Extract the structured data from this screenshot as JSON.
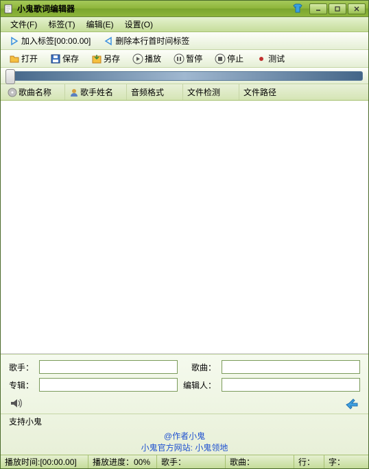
{
  "window": {
    "title": "小鬼歌词编辑器"
  },
  "menubar": [
    "文件(F)",
    "标签(T)",
    "编辑(E)",
    "设置(O)"
  ],
  "toolbar1": {
    "add_tag": "加入标签[00:00.00]",
    "del_tag": "删除本行首时间标签"
  },
  "toolbar2": {
    "open": "打开",
    "save": "保存",
    "saveas": "另存",
    "play": "播放",
    "pause": "暂停",
    "stop": "停止",
    "test": "测试"
  },
  "columns": [
    "歌曲名称",
    "歌手姓名",
    "音频格式",
    "文件检测",
    "文件路径"
  ],
  "meta": {
    "singer_label": "歌手：",
    "song_label": "歌曲：",
    "album_label": "专辑：",
    "editor_label": "编辑人：",
    "singer": "",
    "song": "",
    "album": "",
    "editor": ""
  },
  "support": "支持小鬼",
  "links": {
    "author": "@作者小鬼",
    "site_label": "小鬼官方网站: ",
    "site_name": "小鬼领地"
  },
  "status": {
    "play_time": "播放时间:[00:00.00]",
    "progress": "播放进度：00%",
    "singer": "歌手：",
    "song": "歌曲：",
    "line": "行：",
    "char": "字："
  }
}
